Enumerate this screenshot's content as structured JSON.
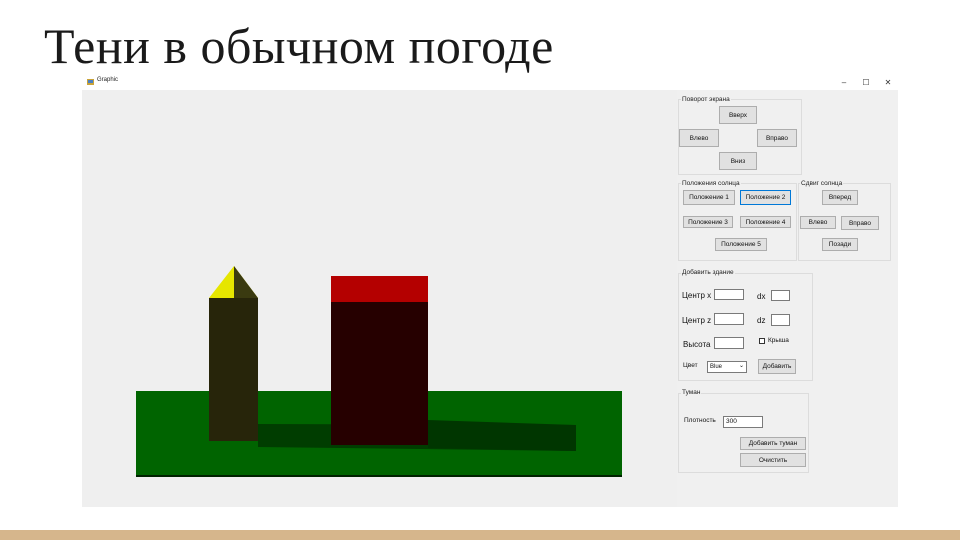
{
  "slide": {
    "title": "Тени в обычном погоде"
  },
  "window": {
    "title": "Graphic",
    "minimize": "–",
    "maximize": "☐",
    "close": "✕"
  },
  "rotate_group": {
    "label": "Поворот экрана",
    "up": "Вверх",
    "left": "Влево",
    "right": "Вправо",
    "down": "Вниз"
  },
  "sun_pos_group": {
    "label": "Положения солнца",
    "pos1": "Положение 1",
    "pos2": "Положение 2",
    "pos3": "Положение 3",
    "pos4": "Положение 4",
    "pos5": "Положение 5"
  },
  "sun_shift_group": {
    "label": "Сдвиг солнца",
    "forward": "Вперед",
    "left": "Влево",
    "right": "Вправо",
    "back": "Позади"
  },
  "building_group": {
    "label": "Добавить здание",
    "center_x": "Центр x",
    "dx": "dx",
    "center_z": "Центр z",
    "dz": "dz",
    "height": "Высота",
    "roof": "Крыша",
    "color_label": "Цвет",
    "color_value": "Blue",
    "add": "Добавить"
  },
  "fog_group": {
    "label": "Туман",
    "density_label": "Плотность",
    "density_value": "300",
    "add_fog": "Добавить туман",
    "clear": "Очистить"
  },
  "colors": {
    "ground": "#006400",
    "roof_red": "#b40000",
    "pyramid": "#e6e600",
    "building1": "#27250a",
    "building2": "#260000",
    "shadow": "#003d00",
    "bottom_bar": "#d6b68c"
  }
}
